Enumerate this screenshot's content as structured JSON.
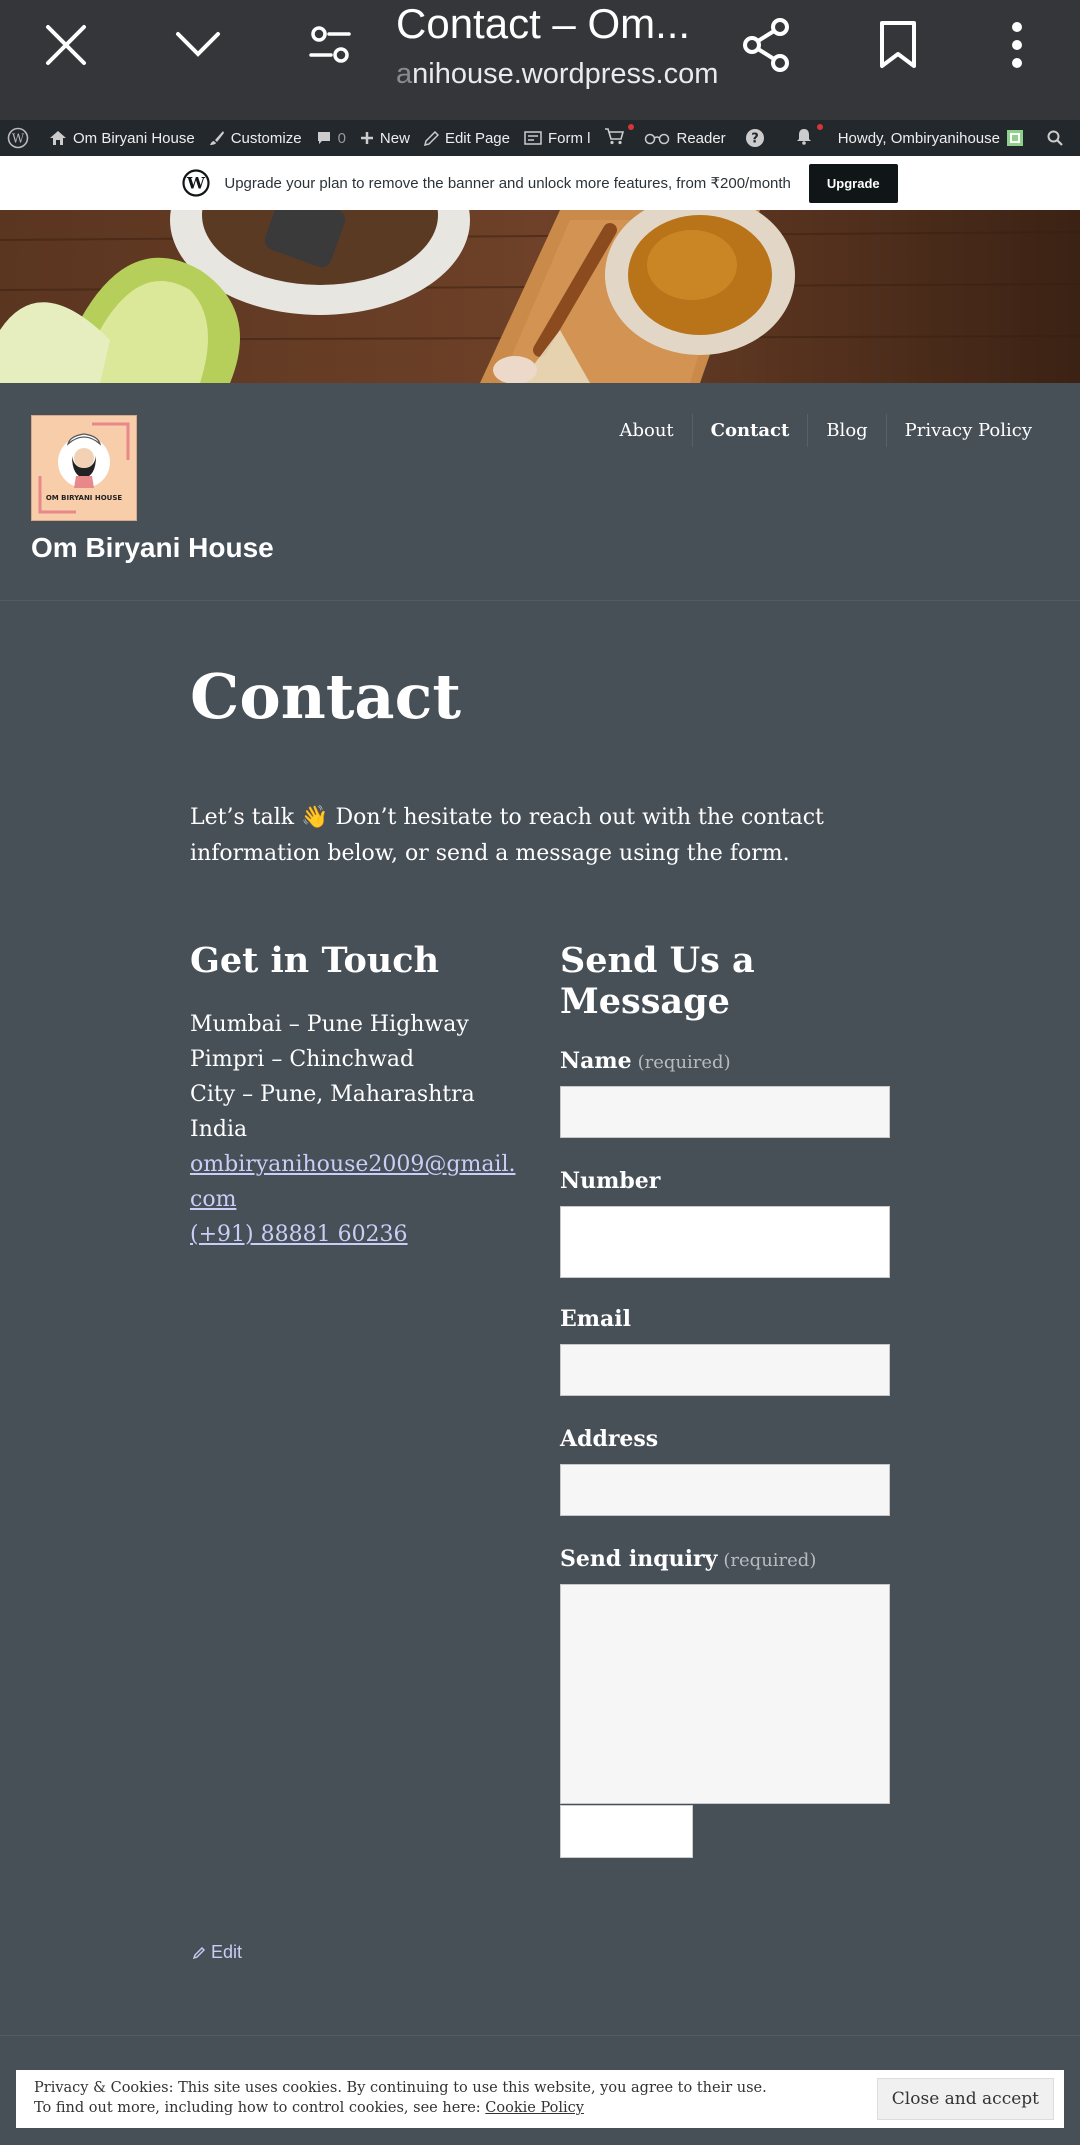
{
  "browser": {
    "tab_title": "Contact – Om...",
    "url_fade": "a",
    "url_main": "nihouse.wordpress.com"
  },
  "adminbar": {
    "site": "Om Biryani House",
    "customize": "Customize",
    "comments_count": "0",
    "new": "New",
    "edit_page": "Edit Page",
    "form": "Form l",
    "reader": "Reader",
    "howdy": "Howdy, Ombiryanihouse"
  },
  "banner": {
    "text": "Upgrade your plan to remove the banner and unlock more features, from ₹200/month",
    "button": "Upgrade"
  },
  "site": {
    "title": "Om Biryani House",
    "logo_text": "OM BIRYANI HOUSE",
    "nav": [
      "About",
      "Contact",
      "Blog",
      "Privacy Policy"
    ]
  },
  "page": {
    "title": "Contact",
    "intro": "Let’s talk 👋 Don’t hesitate to reach out with the contact information below, or send a message using the form."
  },
  "contact": {
    "heading": "Get in Touch",
    "address": [
      "Mumbai – Pune Highway",
      "Pimpri – Chinchwad",
      "City – Pune, Maharashtra",
      "India"
    ],
    "email": "ombiryanihouse2009@gmail.com",
    "phone": "(+91) 88881 60236"
  },
  "form": {
    "heading": "Send Us a Message",
    "name_label": "Name",
    "required": "(required)",
    "number_label": "Number",
    "email_label": "Email",
    "address_label": "Address",
    "inquiry_label": "Send inquiry"
  },
  "footer": {
    "edit": "Edit"
  },
  "cookie": {
    "line1": "Privacy & Cookies: This site uses cookies. By continuing to use this website, you agree to their use.",
    "line2_prefix": "To find out more, including how to control cookies, see here:",
    "policy_link": "Cookie Policy",
    "button": "Close and accept"
  }
}
